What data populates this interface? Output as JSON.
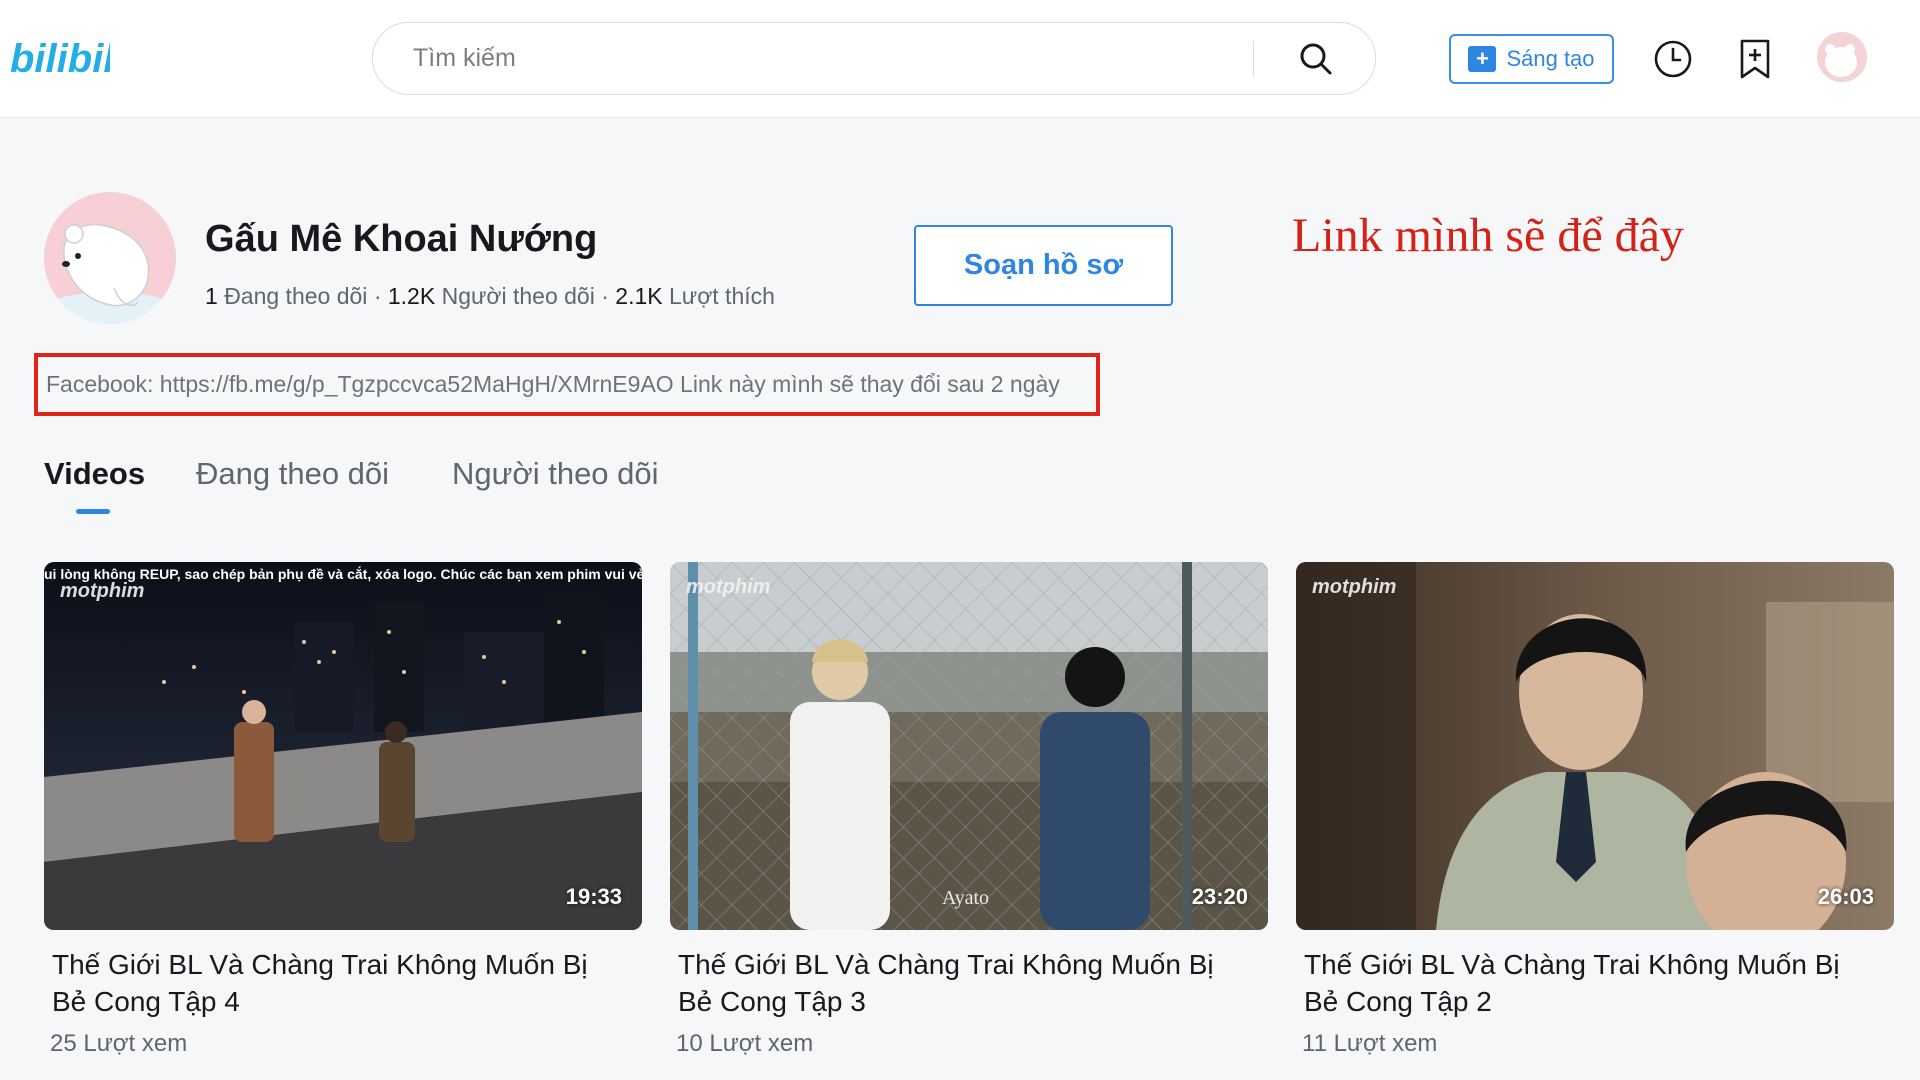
{
  "header": {
    "logo_text": "bilibili",
    "search_placeholder": "Tìm kiếm",
    "create_label": "Sáng tạo"
  },
  "profile": {
    "name": "Gấu Mê Khoai Nướng",
    "following_count": "1",
    "following_label": "Đang theo dõi",
    "followers_count": "1.2K",
    "followers_label": "Người theo dõi",
    "likes_count": "2.1K",
    "likes_label": "Lượt thích",
    "edit_label": "Soạn hồ sơ",
    "bio": "Facebook: https://fb.me/g/p_Tgzpccvca52MaHgH/XMrnE9AO Link này mình sẽ thay đổi sau 2 ngày"
  },
  "annotation": {
    "note": "Link mình sẽ để đây",
    "color": "#d42216",
    "box_color": "#e0241a"
  },
  "tabs": [
    {
      "label": "Videos",
      "active": true
    },
    {
      "label": "Đang theo dõi",
      "active": false
    },
    {
      "label": "Người theo dõi",
      "active": false
    }
  ],
  "videos": [
    {
      "title_line1": "Thế Giới BL Và Chàng Trai Không Muốn Bị",
      "title_line2": "Bẻ Cong Tập 4",
      "views": "25 Lượt xem",
      "duration": "19:33",
      "watermark": "motphim",
      "caption": "ui lòng không REUP, sao chép bản phụ đề và cắt, xóa logo. Chúc các bạn xem phim vui vẻ"
    },
    {
      "title_line1": "Thế Giới BL Và Chàng Trai Không Muốn Bị",
      "title_line2": "Bẻ Cong Tập 3",
      "views": "10 Lượt xem",
      "duration": "23:20",
      "watermark": "motphim",
      "credit": "Ayato"
    },
    {
      "title_line1": "Thế Giới BL Và Chàng Trai Không Muốn Bị",
      "title_line2": "Bẻ Cong Tập 2",
      "views": "11 Lượt xem",
      "duration": "26:03",
      "watermark": "motphim"
    }
  ],
  "colors": {
    "accent": "#2f86e0",
    "text_primary": "#18191c",
    "text_secondary": "#61666d"
  }
}
